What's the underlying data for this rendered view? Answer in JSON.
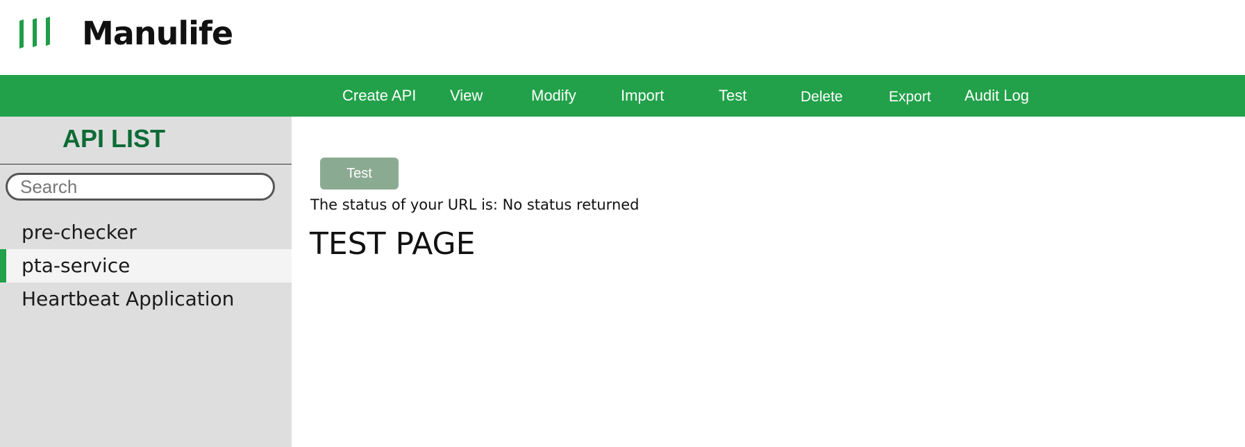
{
  "header": {
    "logo_text": "Manulife",
    "brand_color": "#22a14a"
  },
  "nav": {
    "items": [
      {
        "label": "Create API"
      },
      {
        "label": "View"
      },
      {
        "label": "Modify"
      },
      {
        "label": "Import"
      },
      {
        "label": "Test"
      },
      {
        "label": "Delete"
      },
      {
        "label": "Export"
      },
      {
        "label": "Audit Log"
      }
    ]
  },
  "sidebar": {
    "title": "API LIST",
    "title_color": "#0d6b35",
    "search": {
      "placeholder": "Search",
      "value": ""
    },
    "items": [
      {
        "label": "pre-checker",
        "active": false
      },
      {
        "label": "pta-service",
        "active": true
      },
      {
        "label": "Heartbeat Application",
        "active": false
      }
    ]
  },
  "main": {
    "test_button_label": "Test",
    "status_text": "The status of your URL is: No status returned",
    "heading": "TEST PAGE"
  }
}
